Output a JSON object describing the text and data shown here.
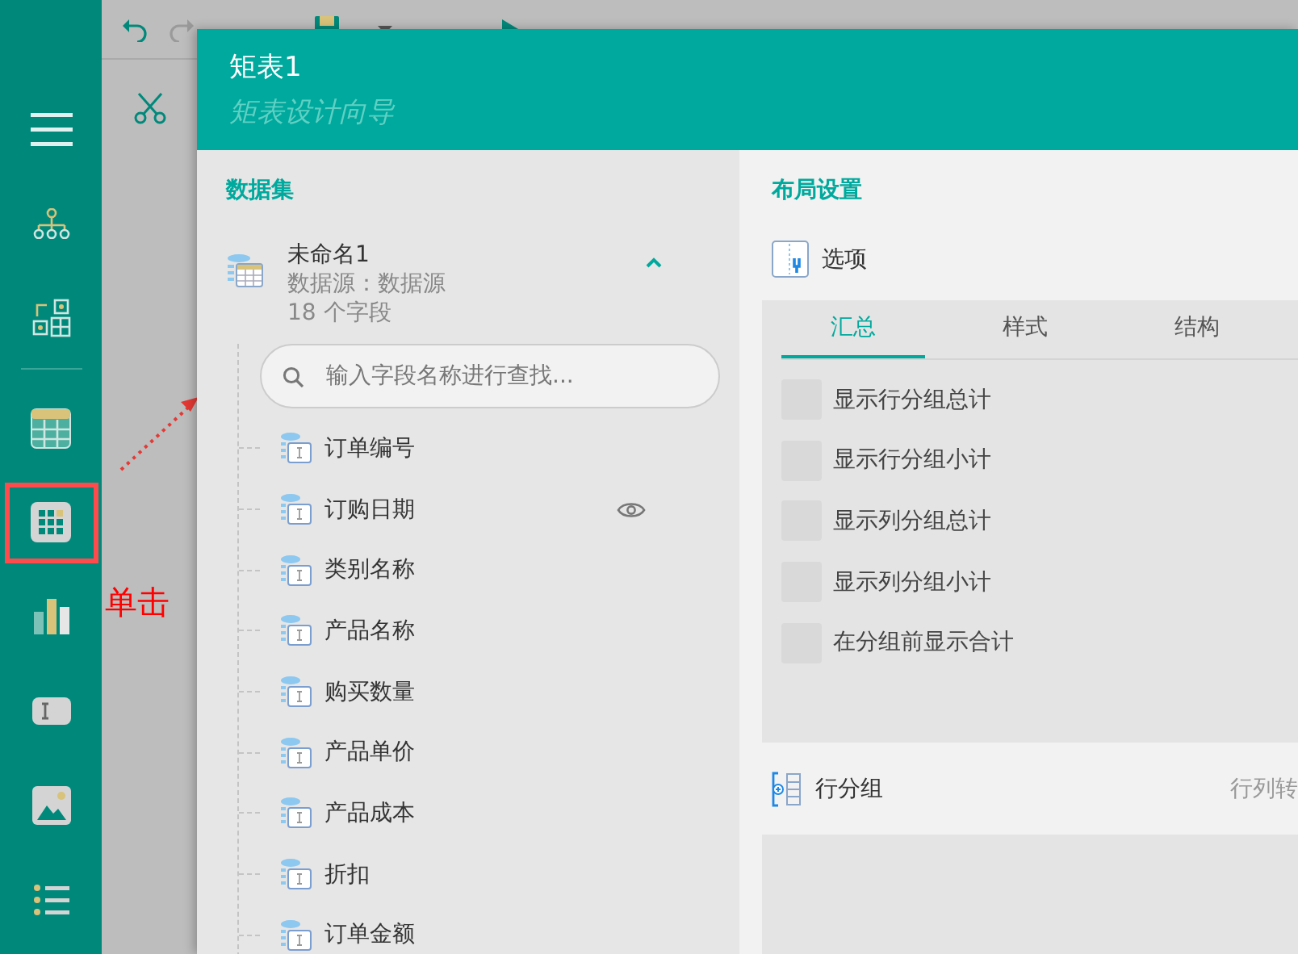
{
  "toolbar": {
    "items": [
      {
        "kind": "undo"
      },
      {
        "kind": "redo"
      },
      {
        "kind": "save"
      },
      {
        "kind": "dropdown"
      },
      {
        "kind": "preview"
      }
    ]
  },
  "sidebar": {
    "items": [
      {
        "kind": "menu",
        "highlighted": false
      },
      {
        "kind": "tree",
        "highlighted": false
      },
      {
        "kind": "layout",
        "highlighted": false
      },
      {
        "kind": "divider"
      },
      {
        "kind": "table",
        "highlighted": false
      },
      {
        "kind": "matrix",
        "highlighted": true
      },
      {
        "kind": "chart",
        "highlighted": false
      },
      {
        "kind": "text",
        "highlighted": false
      },
      {
        "kind": "image",
        "highlighted": false
      },
      {
        "kind": "list",
        "highlighted": false
      }
    ]
  },
  "annotation": {
    "label": "单击"
  },
  "dialog": {
    "title": "矩表1",
    "subtitle": "矩表设计向导",
    "dataset_panel": {
      "heading": "数据集",
      "dataset": {
        "name": "未命名1",
        "source": "数据源：数据源",
        "field_count": "18 个字段",
        "expanded": true
      },
      "search": {
        "placeholder": "输入字段名称进行查找..."
      },
      "fields": [
        {
          "name": "订单编号",
          "hovered": false
        },
        {
          "name": "订购日期",
          "hovered": true
        },
        {
          "name": "类别名称",
          "hovered": false
        },
        {
          "name": "产品名称",
          "hovered": false
        },
        {
          "name": "购买数量",
          "hovered": false
        },
        {
          "name": "产品单价",
          "hovered": false
        },
        {
          "name": "产品成本",
          "hovered": false
        },
        {
          "name": "折扣",
          "hovered": false
        },
        {
          "name": "订单金额",
          "hovered": false
        }
      ]
    },
    "layout_panel": {
      "heading": "布局设置",
      "options_label": "选项",
      "tabs": [
        {
          "label": "汇总",
          "selected": true
        },
        {
          "label": "样式",
          "selected": false
        },
        {
          "label": "结构",
          "selected": false
        }
      ],
      "checkboxes": [
        {
          "label": "显示行分组总计",
          "checked": false
        },
        {
          "label": "显示行分组小计",
          "checked": false
        },
        {
          "label": "显示列分组总计",
          "checked": false
        },
        {
          "label": "显示列分组小计",
          "checked": false
        },
        {
          "label": "在分组前显示合计",
          "checked": false
        }
      ],
      "row_group": {
        "label": "行分组",
        "action": "行列转"
      }
    }
  }
}
